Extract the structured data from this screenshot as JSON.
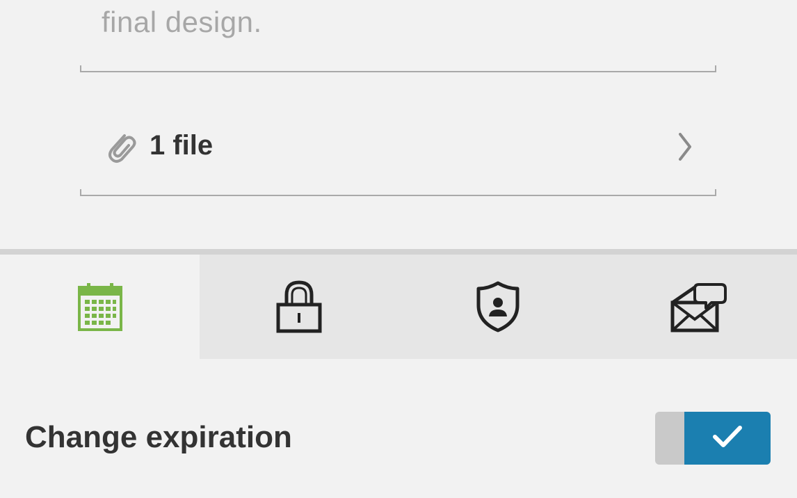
{
  "message": {
    "text_fragment": "final design."
  },
  "attachment": {
    "label": "1 file",
    "icon": "paperclip-icon"
  },
  "tabs": [
    {
      "name": "expiration",
      "icon": "calendar-icon",
      "active": true
    },
    {
      "name": "password",
      "icon": "lock-icon",
      "active": false
    },
    {
      "name": "security",
      "icon": "shield-user-icon",
      "active": false
    },
    {
      "name": "notifications",
      "icon": "envelope-chat-icon",
      "active": false
    }
  ],
  "settings": {
    "change_expiration": {
      "label": "Change expiration",
      "enabled": true
    }
  },
  "colors": {
    "active_tab_icon": "#7ab648",
    "toggle_on": "#1b7fb0",
    "background": "#f2f2f2",
    "inactive_tab_bg": "#e6e6e6"
  }
}
